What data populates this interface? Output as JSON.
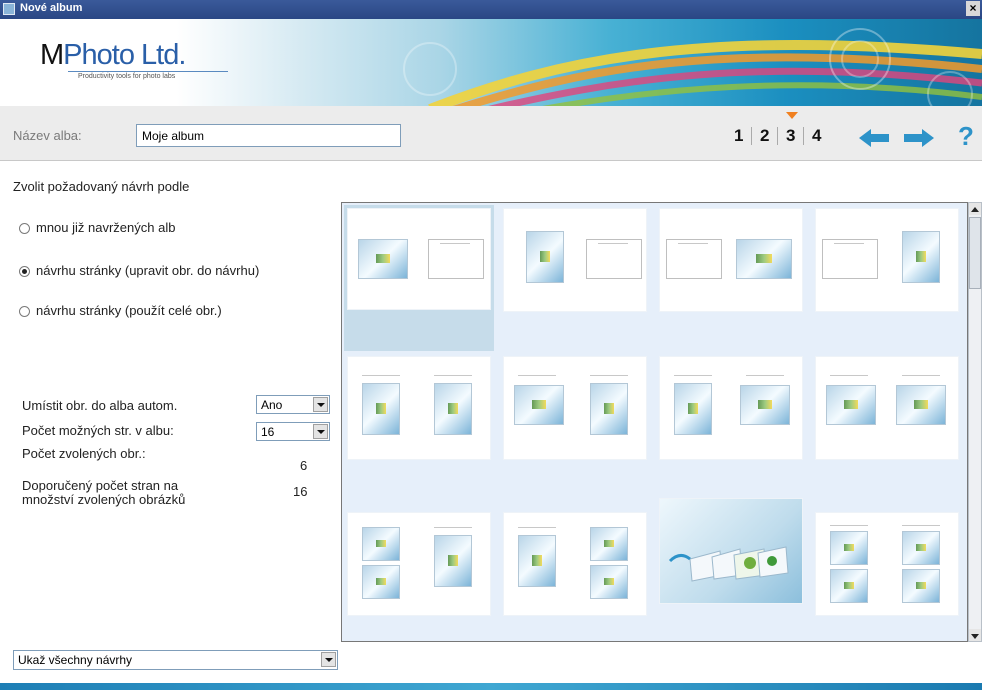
{
  "window": {
    "title": "Nové album",
    "close": "×"
  },
  "brand": {
    "name_m": "M",
    "name_rest": "Photo",
    "name_ltd": " Ltd.",
    "tagline": "Productivity tools for photo labs"
  },
  "namebar": {
    "album_label": "Název alba:",
    "album_value": "Moje album",
    "steps": [
      "1",
      "2",
      "3",
      "4"
    ],
    "current_step": "3",
    "help": "?"
  },
  "design": {
    "heading": "Zvolit požadovaný návrh podle",
    "options": [
      {
        "label": "mnou již navržených alb",
        "selected": false
      },
      {
        "label": "návrhu stránky (upravit obr. do návrhu)",
        "selected": true
      },
      {
        "label": "návrhu stránky (použít celé obr.)",
        "selected": false
      }
    ]
  },
  "settings": {
    "auto_place_label": "Umístit obr. do alba autom.",
    "auto_place_value": "Ano",
    "pages_label": "Počet možných str. v albu:",
    "pages_value": "16",
    "chosen_label": "Počet zvolených obr.:",
    "chosen_value": "6",
    "recommended_label_1": "Doporučený počet stran na",
    "recommended_label_2": "množství zvolených obrázků",
    "recommended_value": "16"
  },
  "filter": {
    "value": "Ukaž všechny návrhy"
  },
  "colors": {
    "accent": "#2d93c9",
    "step_marker": "#f08020",
    "selection": "#c6dcea"
  }
}
